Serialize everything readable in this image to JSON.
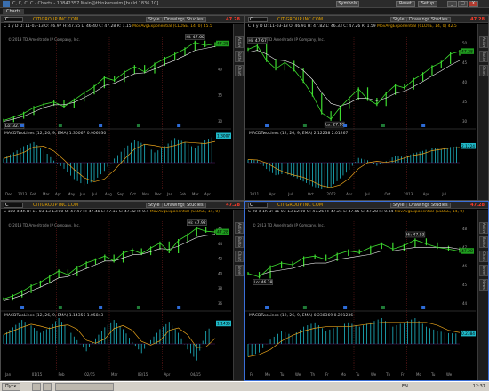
{
  "window": {
    "title": "C, C, C, C - Charts - 10842357 Main@thinkorswim [build 1836.10]",
    "tab": "Charts",
    "toolbar_buttons": [
      "Symbols",
      "Reset",
      "Setup"
    ],
    "controls": [
      "_",
      "□",
      "X"
    ]
  },
  "panels": [
    {
      "symbol": "C",
      "company": "CITIGROUP INC COM",
      "buttons": [
        "Style",
        "Drawings",
        "Studies"
      ],
      "price": "47.28",
      "quote": "C 1 y D  D: 11-03-13  O: 46.97  H: 47.55  L: 46.40  C: 47.28  R: 1.15",
      "study": "MovAvgExponential (CLOSE, 14, 0) 45.5",
      "copyright": "© 2013 TD Ameritrade IP Company, Inc.",
      "hi_label": "Hi: 47.60",
      "lo_label": "Lo: 32.73",
      "macd_text": "MACDTwoLines (12, 26, 9, EMA)  1.30067  0.906030",
      "macd_value": "1.3007",
      "price_label": "47.28",
      "y_ticks": [
        "45",
        "40",
        "35",
        "30"
      ],
      "x_ticks": [
        "Dec",
        "2013",
        "Feb",
        "Mar",
        "Apr",
        "May",
        "Jun",
        "Jul",
        "Aug",
        "Sep",
        "Oct",
        "Nov",
        "Dec",
        "Jan",
        "Feb",
        "Mar",
        "Apr"
      ],
      "sidebar": [
        "Active Trader",
        "Buttons",
        "Chart"
      ],
      "chart_data": {
        "type": "line",
        "price": [
          31.2,
          31.9,
          32.7,
          33.9,
          34.6,
          35.1,
          34.1,
          35.5,
          37.0,
          38.3,
          40.2,
          39.6,
          41.3,
          42.5,
          41.4,
          43.0,
          44.2,
          45.1,
          46.2,
          47.6,
          46.9,
          47.28
        ],
        "ema": [
          31.0,
          31.5,
          32.1,
          33.0,
          33.9,
          34.5,
          34.5,
          35.0,
          36.0,
          37.1,
          38.5,
          39.0,
          40.0,
          41.0,
          41.2,
          42.0,
          43.0,
          43.8,
          44.8,
          45.9,
          46.3,
          46.7
        ],
        "macd": [
          0.2,
          0.5,
          0.8,
          1.0,
          0.6,
          0.1,
          -0.3,
          -0.8,
          -1.1,
          -0.9,
          -0.4,
          0.2,
          0.7,
          1.1,
          0.9,
          0.5,
          0.8,
          1.2,
          1.0,
          0.7,
          1.1,
          1.3
        ],
        "ylim": [
          30,
          49
        ]
      }
    },
    {
      "symbol": "C",
      "company": "CITIGROUP INC COM",
      "buttons": [
        "Style",
        "Drawings",
        "Studies"
      ],
      "price": "47.28",
      "quote": "C 3 y D  D: 11-03-13  O: 46.91  H: 47.82  L: 46.33  C: 47.26  R: 1.59",
      "study": "MovAvgExponential (CLOSE, 14, 0) 42.5",
      "copyright": "© 2013 TD Ameritrade IP Company, Inc.",
      "hi_label": "Hi: 47.67",
      "lo_label": "Lo: 27.10",
      "macd_text": "MACDTwoLines (12, 26, 9, EMA)  2.12238  2.01267",
      "macd_value": "2.1224",
      "price_label": "47.28",
      "y_ticks": [
        "50",
        "45",
        "40",
        "35",
        "30"
      ],
      "x_ticks": [
        "2011",
        "Apr",
        "Jul",
        "Oct",
        "2012",
        "Apr",
        "Jul",
        "Oct",
        "2013",
        "Apr",
        "Jul"
      ],
      "sidebar": [
        "Active Trader",
        "Buttons",
        "Chart"
      ],
      "chart_data": {
        "type": "line",
        "price": [
          47.9,
          49.0,
          44.6,
          42.1,
          44.0,
          41.8,
          38.4,
          34.3,
          29.0,
          27.1,
          30.6,
          33.4,
          36.1,
          33.0,
          31.5,
          34.8,
          37.2,
          36.4,
          38.9,
          40.6,
          42.7,
          44.0,
          46.5,
          47.28
        ],
        "ema": [
          47.0,
          47.6,
          46.5,
          44.8,
          44.5,
          43.5,
          41.6,
          38.9,
          35.0,
          31.8,
          31.0,
          31.9,
          33.4,
          33.3,
          32.6,
          33.4,
          34.8,
          35.4,
          36.8,
          38.3,
          40.0,
          41.5,
          43.2,
          44.6
        ],
        "macd": [
          0.4,
          0.3,
          -0.8,
          -1.6,
          -1.4,
          -1.8,
          -2.4,
          -3.0,
          -3.4,
          -3.1,
          -2.0,
          -0.9,
          0.6,
          0.3,
          -0.4,
          0.2,
          0.9,
          0.7,
          1.2,
          1.5,
          1.9,
          1.7,
          2.0,
          2.1
        ],
        "ylim": [
          25,
          52
        ]
      }
    },
    {
      "symbol": "C",
      "company": "CITIGROUP INC COM",
      "buttons": [
        "Style",
        "Drawings",
        "Studies"
      ],
      "price": "47.28",
      "quote": "C 180 d 4h  D: 11-03-13 13:00  O: 47.47  H: 47.48  L: 47.15  C: 47.32  R: 0.4",
      "study": "MovAvgExponential (CLOSE, 14, 0)",
      "copyright": "© 2013 TD Ameritrade IP Company, Inc.",
      "hi_label": "Hi: 47.92",
      "lo_label": "",
      "macd_text": "MACDTwoLines (12, 26, 9, EMA)  1.14356  1.05843",
      "macd_value": "1.1436",
      "price_label": "47.28",
      "y_ticks": [
        "46",
        "44",
        "42",
        "40",
        "38",
        "36"
      ],
      "x_ticks": [
        "Jan",
        "01/15",
        "Feb",
        "02/15",
        "Mar",
        "03/15",
        "Apr",
        "04/15"
      ],
      "sidebar": [
        "Active Trader",
        "Buttons",
        "Chart",
        "Level II"
      ],
      "chart_data": {
        "type": "line",
        "price": [
          36.5,
          37.0,
          37.7,
          38.6,
          39.2,
          40.1,
          41.0,
          40.4,
          41.6,
          42.3,
          42.8,
          43.4,
          42.6,
          43.9,
          44.4,
          43.8,
          44.7,
          45.5,
          44.1,
          45.9,
          46.8,
          47.9,
          47.4,
          47.28
        ],
        "ema": [
          36.2,
          36.6,
          37.1,
          37.8,
          38.4,
          39.1,
          39.9,
          40.1,
          40.8,
          41.4,
          42.0,
          42.6,
          42.6,
          43.1,
          43.6,
          43.7,
          44.1,
          44.6,
          44.5,
          45.0,
          45.7,
          46.4,
          46.7,
          46.9
        ],
        "macd": [
          0.5,
          0.9,
          1.3,
          1.0,
          0.6,
          0.9,
          1.4,
          0.8,
          0.2,
          -0.4,
          0.3,
          0.9,
          1.3,
          0.8,
          0.1,
          -0.5,
          0.2,
          0.8,
          1.2,
          0.6,
          -0.3,
          -0.9,
          0.7,
          1.1
        ],
        "ylim": [
          35,
          49
        ]
      }
    },
    {
      "symbol": "C",
      "company": "CITIGROUP INC COM",
      "buttons": [
        "Style",
        "Drawings",
        "Studies"
      ],
      "price": "47.28",
      "quote": "C 20 d 1h  D: 11-03-13 12:00  O: 47.26  H: 47.24  L: 47.05  C: 47.28  R: 0.34",
      "study": "MovAvgExponential (CLOSE, 14, 0)",
      "copyright": "© 2013 TD Ameritrade IP Company, Inc.",
      "hi_label": "Hi: 47.93",
      "lo_label": "Lo: 46.38",
      "macd_text": "MACDTwoLines (12, 26, 9, EMA)  0.238369  0.291236",
      "macd_value": "0.2384",
      "price_label": "47.28",
      "y_ticks": [
        "48",
        "47",
        "46",
        "45",
        "44"
      ],
      "x_ticks": [
        "Fr",
        "Mo",
        "Tu",
        "We",
        "Th",
        "Fr",
        "Mo",
        "Tu",
        "We",
        "Th",
        "Fr",
        "Mo",
        "Tu",
        "We"
      ],
      "sidebar": [
        "Active Trader",
        "Buttons",
        "Chart",
        "Level II",
        "News"
      ],
      "chart_data": {
        "type": "line",
        "price": [
          46.0,
          45.8,
          46.38,
          46.6,
          46.5,
          46.9,
          47.0,
          46.8,
          47.1,
          47.3,
          47.2,
          47.5,
          47.7,
          47.4,
          47.6,
          47.93,
          47.7,
          47.5,
          47.4,
          47.28
        ],
        "ema": [
          45.9,
          45.9,
          46.1,
          46.2,
          46.3,
          46.5,
          46.6,
          46.6,
          46.8,
          46.9,
          47.0,
          47.1,
          47.3,
          47.3,
          47.4,
          47.5,
          47.5,
          47.5,
          47.5,
          47.4
        ],
        "macd": [
          -0.3,
          -0.2,
          0.1,
          0.3,
          0.2,
          0.4,
          0.5,
          0.3,
          0.4,
          0.5,
          0.4,
          0.5,
          0.6,
          0.4,
          0.5,
          0.6,
          0.4,
          0.3,
          0.25,
          0.24
        ],
        "ylim": [
          44,
          49
        ]
      }
    }
  ],
  "taskbar": {
    "start_label": "Пуск",
    "lang": "EN",
    "clock": "12:37"
  },
  "colors": {
    "price_line": "#3ddc2f",
    "ema_line": "#f0f0f0",
    "histogram": "#1fb8c7",
    "signal_line": "#e7a21a",
    "price_badge": "#e02323",
    "accent": "#e0a000"
  }
}
